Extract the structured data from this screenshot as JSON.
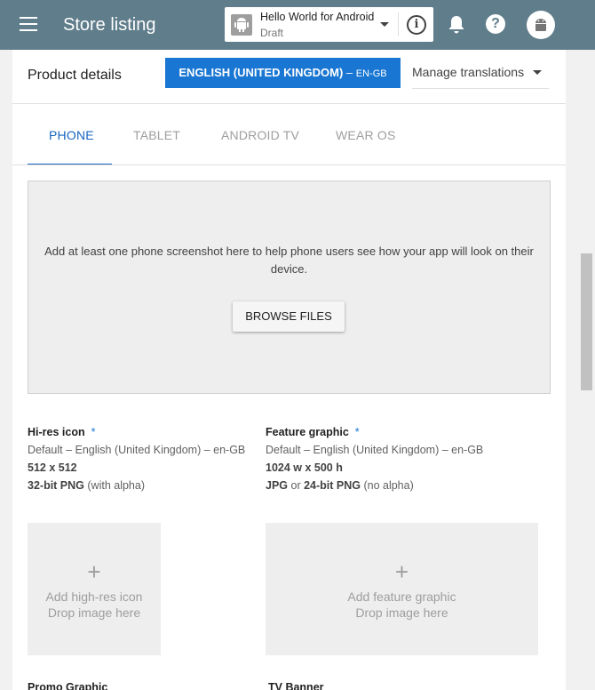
{
  "appbar": {
    "title": "Store listing",
    "app_selector": {
      "app_name": "Hello World for Android",
      "status": "Draft"
    },
    "bg_color": "#607d8b"
  },
  "product": {
    "title": "Product details",
    "language_button": {
      "name": "ENGLISH (UNITED KINGDOM)",
      "separator": " – ",
      "code": "EN-GB"
    },
    "manage_translations": "Manage translations"
  },
  "tabs": [
    {
      "label": "PHONE",
      "active": true
    },
    {
      "label": "TABLET",
      "active": false
    },
    {
      "label": "ANDROID TV",
      "active": false
    },
    {
      "label": "WEAR OS",
      "active": false
    }
  ],
  "screenshots": {
    "prompt": "Add at least one phone screenshot here to help phone users see how your app will look on their device.",
    "browse_label": "BROWSE FILES"
  },
  "assets": {
    "hires_icon": {
      "title": "Hi-res icon",
      "required_mark": "*",
      "language": "Default – English (United Kingdom) – en-GB",
      "size": "512 x 512",
      "format_bold": "32-bit PNG",
      "format_rest": " (with alpha)",
      "drop_plus": "+",
      "drop_line1": "Add high-res icon",
      "drop_line2": "Drop image here"
    },
    "feature_graphic": {
      "title": "Feature graphic",
      "required_mark": "*",
      "language": "Default – English (United Kingdom) – en-GB",
      "size": "1024 w x 500 h",
      "format_bold1": "JPG",
      "format_mid": " or ",
      "format_bold2": "24-bit PNG",
      "format_rest": " (no alpha)",
      "drop_plus": "+",
      "drop_line1": "Add feature graphic",
      "drop_line2": "Drop image here"
    }
  },
  "next_sections": {
    "promo_graphic": "Promo Graphic",
    "tv_banner": "TV Banner"
  },
  "colors": {
    "accent": "#1976d2",
    "tab_active": "#1565c0"
  }
}
